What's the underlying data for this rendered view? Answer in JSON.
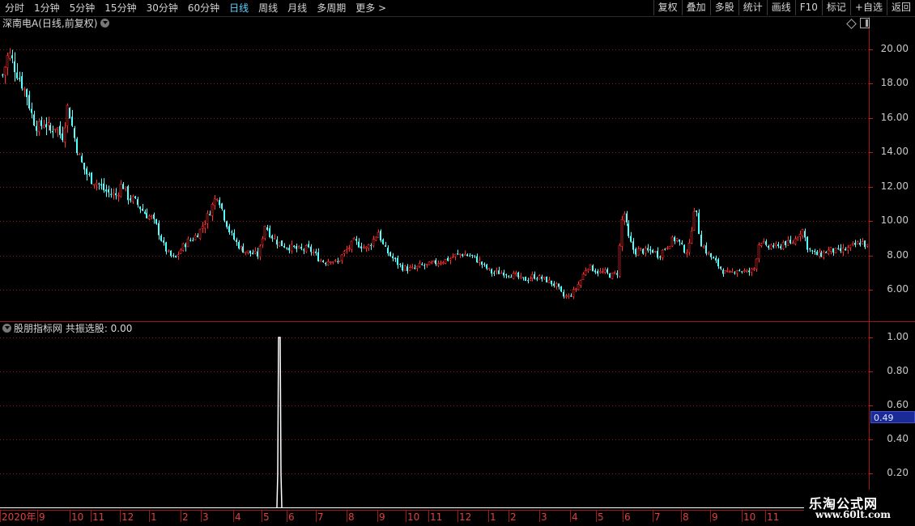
{
  "toolbar": {
    "periods": [
      "分时",
      "1分钟",
      "5分钟",
      "15分钟",
      "30分钟",
      "60分钟",
      "日线",
      "周线",
      "月线",
      "多周期",
      "更多 >"
    ],
    "active_period": "日线",
    "buttons": [
      "复权",
      "叠加",
      "多股",
      "统计",
      "画线",
      "F10",
      "标记",
      "+自选",
      "返回"
    ]
  },
  "main_chart": {
    "title": "深南电A(日线,前复权)",
    "y_ticks": [
      "20.00",
      "18.00",
      "16.00",
      "14.00",
      "12.00",
      "10.00",
      "8.00",
      "6.00"
    ]
  },
  "indicator": {
    "title": "股朋指标网 共振选股: 0.00",
    "y_ticks": [
      "1.00",
      "0.80",
      "0.60",
      "0.40",
      "0.20"
    ],
    "current_value": "0.49"
  },
  "date_axis": [
    "2020年",
    "9",
    "10",
    "11",
    "12",
    "1",
    "2",
    "3",
    "4",
    "5",
    "6",
    "7",
    "8",
    "9",
    "10",
    "11",
    "12",
    "1",
    "2",
    "3",
    "4",
    "5",
    "6",
    "7",
    "8",
    "9",
    "10",
    "11"
  ],
  "watermark": {
    "name": "乐淘公式网",
    "url": "www.60lt.com"
  },
  "colors": {
    "up": "#ff3030",
    "down": "#54ffff",
    "grid": "#8b1a1a",
    "active_tab": "#5fd3ff",
    "signal": "#ffffff"
  },
  "chart_data": {
    "type": "candlestick",
    "price_ylim": [
      4.8,
      21.4
    ],
    "close_series_approx": [
      18.5,
      19.8,
      19.0,
      18.2,
      17.4,
      16.0,
      15.4,
      15.8,
      15.2,
      15.6,
      14.8,
      16.8,
      15.0,
      13.6,
      12.8,
      12.4,
      12.2,
      11.8,
      11.6,
      11.5,
      12.2,
      11.4,
      11.2,
      10.8,
      10.4,
      10.2,
      9.6,
      8.6,
      8.0,
      7.8,
      8.4,
      8.8,
      9.0,
      9.4,
      10.0,
      10.8,
      11.6,
      10.4,
      9.4,
      8.8,
      8.4,
      8.2,
      8.1,
      8.0,
      9.8,
      9.2,
      8.8,
      8.6,
      8.5,
      8.4,
      8.3,
      8.4,
      8.2,
      7.8,
      7.6,
      7.8,
      7.5,
      8.0,
      8.4,
      8.8,
      8.6,
      8.4,
      8.8,
      9.4,
      8.4,
      8.0,
      7.6,
      7.3,
      7.2,
      7.2,
      7.4,
      7.4,
      7.5,
      7.6,
      7.7,
      7.8,
      8.0,
      8.1,
      8.0,
      7.9,
      7.6,
      7.3,
      7.0,
      7.0,
      7.0,
      6.9,
      6.8,
      6.6,
      6.6,
      6.8,
      6.7,
      6.6,
      6.4,
      6.2,
      5.6,
      5.6,
      6.0,
      6.6,
      7.4,
      7.2,
      7.0,
      7.0,
      6.8,
      7.0,
      10.8,
      9.0,
      8.2,
      8.3,
      8.2,
      8.3,
      8.0,
      8.4,
      8.8,
      9.0,
      8.4,
      8.2,
      11.0,
      8.8,
      8.2,
      7.8,
      7.4,
      7.0,
      6.9,
      7.2,
      7.1,
      7.0,
      7.2,
      9.0,
      8.4,
      8.6,
      8.4,
      8.8,
      8.6,
      9.0,
      9.6,
      8.4,
      8.1,
      8.0,
      8.2,
      8.3,
      8.2,
      8.3,
      8.4,
      8.6,
      8.8,
      8.5
    ]
  }
}
